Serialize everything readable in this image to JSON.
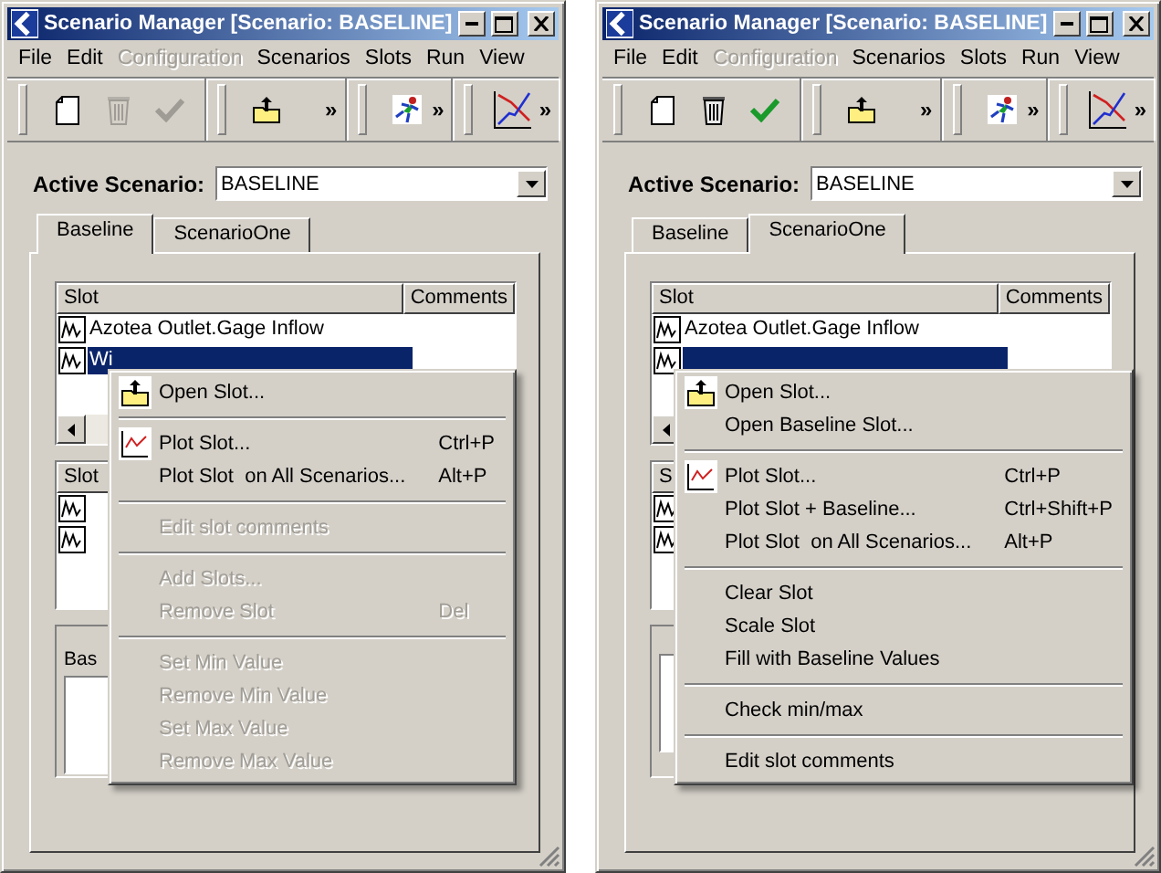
{
  "windows": [
    {
      "title": "Scenario Manager [Scenario: BASELINE]",
      "menubar": [
        {
          "label": "File",
          "disabled": false
        },
        {
          "label": "Edit",
          "disabled": false
        },
        {
          "label": "Configuration",
          "disabled": true
        },
        {
          "label": "Scenarios",
          "disabled": false
        },
        {
          "label": "Slots",
          "disabled": false
        },
        {
          "label": "Run",
          "disabled": false
        },
        {
          "label": "View",
          "disabled": false
        }
      ],
      "toolbar": [
        {
          "buttons": [
            {
              "disabled": false
            },
            {
              "disabled": true
            },
            {
              "disabled": true
            }
          ]
        },
        {
          "buttons": [
            {
              "disabled": false
            }
          ],
          "overflow": "»"
        },
        {
          "buttons": [
            {
              "disabled": false
            }
          ],
          "overflow": "»"
        },
        {
          "buttons": [
            {
              "disabled": false
            }
          ],
          "overflow": "»"
        }
      ],
      "active_scenario": {
        "label": "Active Scenario:",
        "value": "BASELINE"
      },
      "tabs": [
        {
          "label": "Baseline",
          "selected": true
        },
        {
          "label": "ScenarioOne",
          "selected": false
        }
      ],
      "slot_list": {
        "columns": [
          "Slot",
          "Comments"
        ],
        "rows": [
          {
            "name": "Azotea Outlet.Gage Inflow",
            "selected": false
          },
          {
            "name": "Wi",
            "selected": true
          }
        ]
      },
      "lower_list": {
        "header": "Slot"
      },
      "group_label": "Bas",
      "context_menu": [
        {
          "kind": "open",
          "label": "Open Slot...",
          "disabled": false
        },
        {
          "kind": "separator"
        },
        {
          "kind": "plot",
          "label": "Plot Slot...",
          "shortcut": "Ctrl+P",
          "disabled": false
        },
        {
          "kind": "plain",
          "label": "Plot Slot  on All Scenarios...",
          "shortcut": "Alt+P",
          "disabled": false
        },
        {
          "kind": "separator"
        },
        {
          "kind": "plain",
          "label": "Edit slot comments",
          "disabled": true
        },
        {
          "kind": "separator"
        },
        {
          "kind": "plain",
          "label": "Add Slots...",
          "disabled": true
        },
        {
          "kind": "plain",
          "label": "Remove Slot",
          "shortcut": "Del",
          "disabled": true
        },
        {
          "kind": "separator"
        },
        {
          "kind": "plain",
          "label": "Set Min Value",
          "disabled": true
        },
        {
          "kind": "plain",
          "label": "Remove Min Value",
          "disabled": true
        },
        {
          "kind": "plain",
          "label": "Set Max Value",
          "disabled": true
        },
        {
          "kind": "plain",
          "label": "Remove Max Value",
          "disabled": true
        }
      ]
    },
    {
      "title": "Scenario Manager [Scenario: BASELINE]",
      "menubar": [
        {
          "label": "File",
          "disabled": false
        },
        {
          "label": "Edit",
          "disabled": false
        },
        {
          "label": "Configuration",
          "disabled": true
        },
        {
          "label": "Scenarios",
          "disabled": false
        },
        {
          "label": "Slots",
          "disabled": false
        },
        {
          "label": "Run",
          "disabled": false
        },
        {
          "label": "View",
          "disabled": false
        }
      ],
      "toolbar": [
        {
          "buttons": [
            {
              "disabled": false
            },
            {
              "disabled": false
            },
            {
              "disabled": false
            }
          ]
        },
        {
          "buttons": [
            {
              "disabled": false
            }
          ],
          "overflow": "»"
        },
        {
          "buttons": [
            {
              "disabled": false
            }
          ],
          "overflow": "»"
        },
        {
          "buttons": [
            {
              "disabled": false
            }
          ],
          "overflow": "»"
        }
      ],
      "active_scenario": {
        "label": "Active Scenario:",
        "value": "BASELINE"
      },
      "tabs": [
        {
          "label": "Baseline",
          "selected": false
        },
        {
          "label": "ScenarioOne",
          "selected": true
        }
      ],
      "slot_list": {
        "columns": [
          "Slot",
          "Comments"
        ],
        "rows": [
          {
            "name": "Azotea Outlet.Gage Inflow",
            "selected": false
          },
          {
            "selected": true
          }
        ]
      },
      "lower_list": {
        "header": "S"
      },
      "context_menu": [
        {
          "kind": "open",
          "label": "Open Slot...",
          "disabled": false
        },
        {
          "kind": "plain",
          "label": "Open Baseline Slot...",
          "disabled": false
        },
        {
          "kind": "separator"
        },
        {
          "kind": "plot",
          "label": "Plot Slot...",
          "shortcut": "Ctrl+P",
          "disabled": false
        },
        {
          "kind": "plain",
          "label": "Plot Slot + Baseline...",
          "shortcut": "Ctrl+Shift+P",
          "disabled": false
        },
        {
          "kind": "plain",
          "label": "Plot Slot  on All Scenarios...",
          "shortcut": "Alt+P",
          "disabled": false
        },
        {
          "kind": "separator"
        },
        {
          "kind": "plain",
          "label": "Clear Slot",
          "disabled": false
        },
        {
          "kind": "plain",
          "label": "Scale Slot",
          "disabled": false
        },
        {
          "kind": "plain",
          "label": "Fill with Baseline Values",
          "disabled": false
        },
        {
          "kind": "separator"
        },
        {
          "kind": "plain",
          "label": "Check min/max",
          "disabled": false
        },
        {
          "kind": "separator"
        },
        {
          "kind": "plain",
          "label": "Edit slot comments",
          "disabled": false
        }
      ]
    }
  ]
}
